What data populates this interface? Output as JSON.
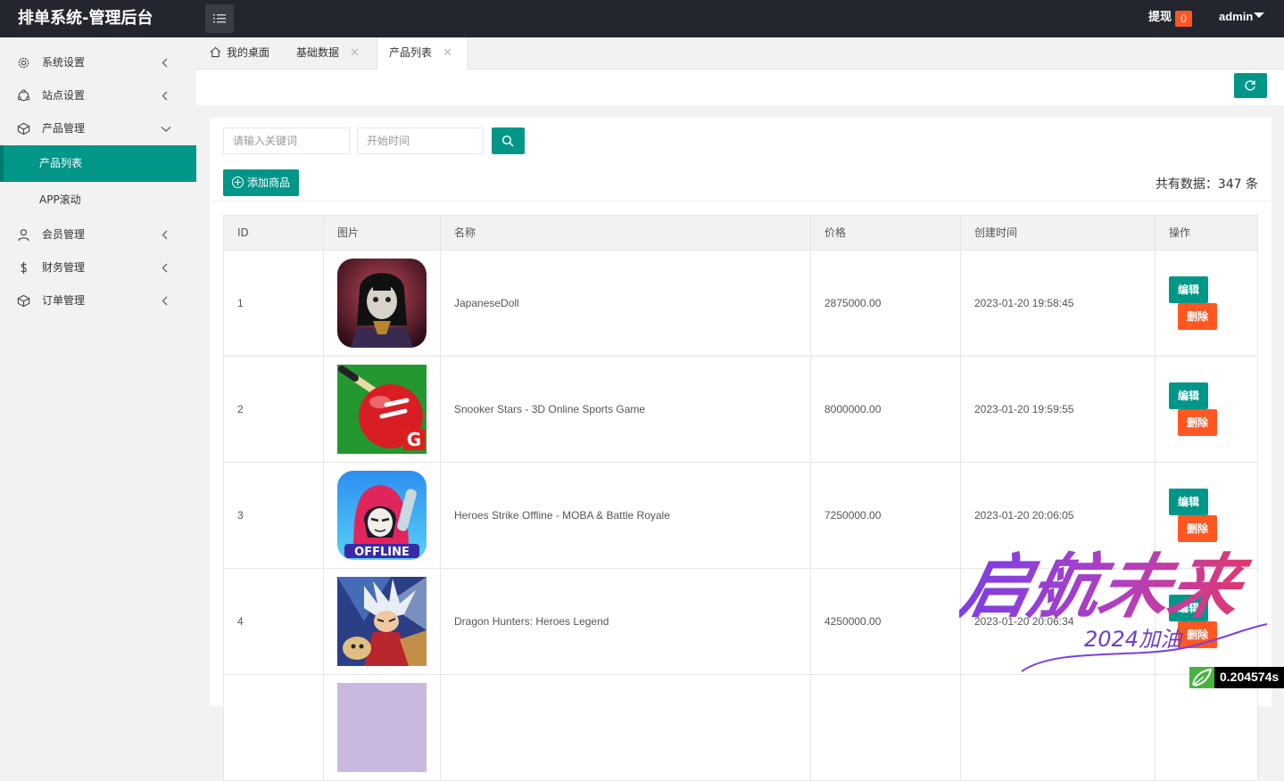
{
  "header": {
    "title": "排单系统-管理后台",
    "withdraw_label": "提现",
    "withdraw_count": "0",
    "user": "admin"
  },
  "sidebar": {
    "items": [
      {
        "label": "系统设置",
        "icon": "gear-icon"
      },
      {
        "label": "站点设置",
        "icon": "network-icon"
      },
      {
        "label": "产品管理",
        "icon": "box-icon"
      },
      {
        "label": "会员管理",
        "icon": "user-icon"
      },
      {
        "label": "财务管理",
        "icon": "dollar-icon"
      },
      {
        "label": "订单管理",
        "icon": "box-icon"
      }
    ],
    "subitems": [
      {
        "label": "产品列表",
        "active": true
      },
      {
        "label": "APP滚动",
        "active": false
      }
    ]
  },
  "tabs": [
    {
      "label": "我的桌面",
      "icon": "home-icon"
    },
    {
      "label": "基础数据"
    },
    {
      "label": "产品列表"
    }
  ],
  "search": {
    "keyword_placeholder": "请输入关键词",
    "date_placeholder": "开始时间"
  },
  "toolbar": {
    "add_label": "添加商品",
    "total_text": "共有数据：347 条"
  },
  "table": {
    "columns": [
      "ID",
      "图片",
      "名称",
      "价格",
      "创建时间",
      "操作"
    ],
    "edit_label": "编辑",
    "delete_label": "删除",
    "rows": [
      {
        "id": "1",
        "name": "JapaneseDoll",
        "price": "2875000.00",
        "created": "2023-01-20 19:58:45"
      },
      {
        "id": "2",
        "name": "Snooker Stars - 3D Online Sports Game",
        "price": "8000000.00",
        "created": "2023-01-20 19:59:55"
      },
      {
        "id": "3",
        "name": "Heroes Strike Offline - MOBA & Battle Royale",
        "price": "7250000.00",
        "created": "2023-01-20 20:06:05"
      },
      {
        "id": "4",
        "name": "Dragon Hunters: Heroes Legend",
        "price": "4250000.00",
        "created": "2023-01-20 20:06:34"
      }
    ]
  },
  "thumb_texts": {
    "offline": "OFFLINE",
    "g": "G"
  },
  "watermark": {
    "main": "启航未来",
    "sub": "2024加油"
  },
  "timer": "0.204574s",
  "colors": {
    "primary": "#009688",
    "danger": "#ff5722",
    "header": "#23262e"
  }
}
